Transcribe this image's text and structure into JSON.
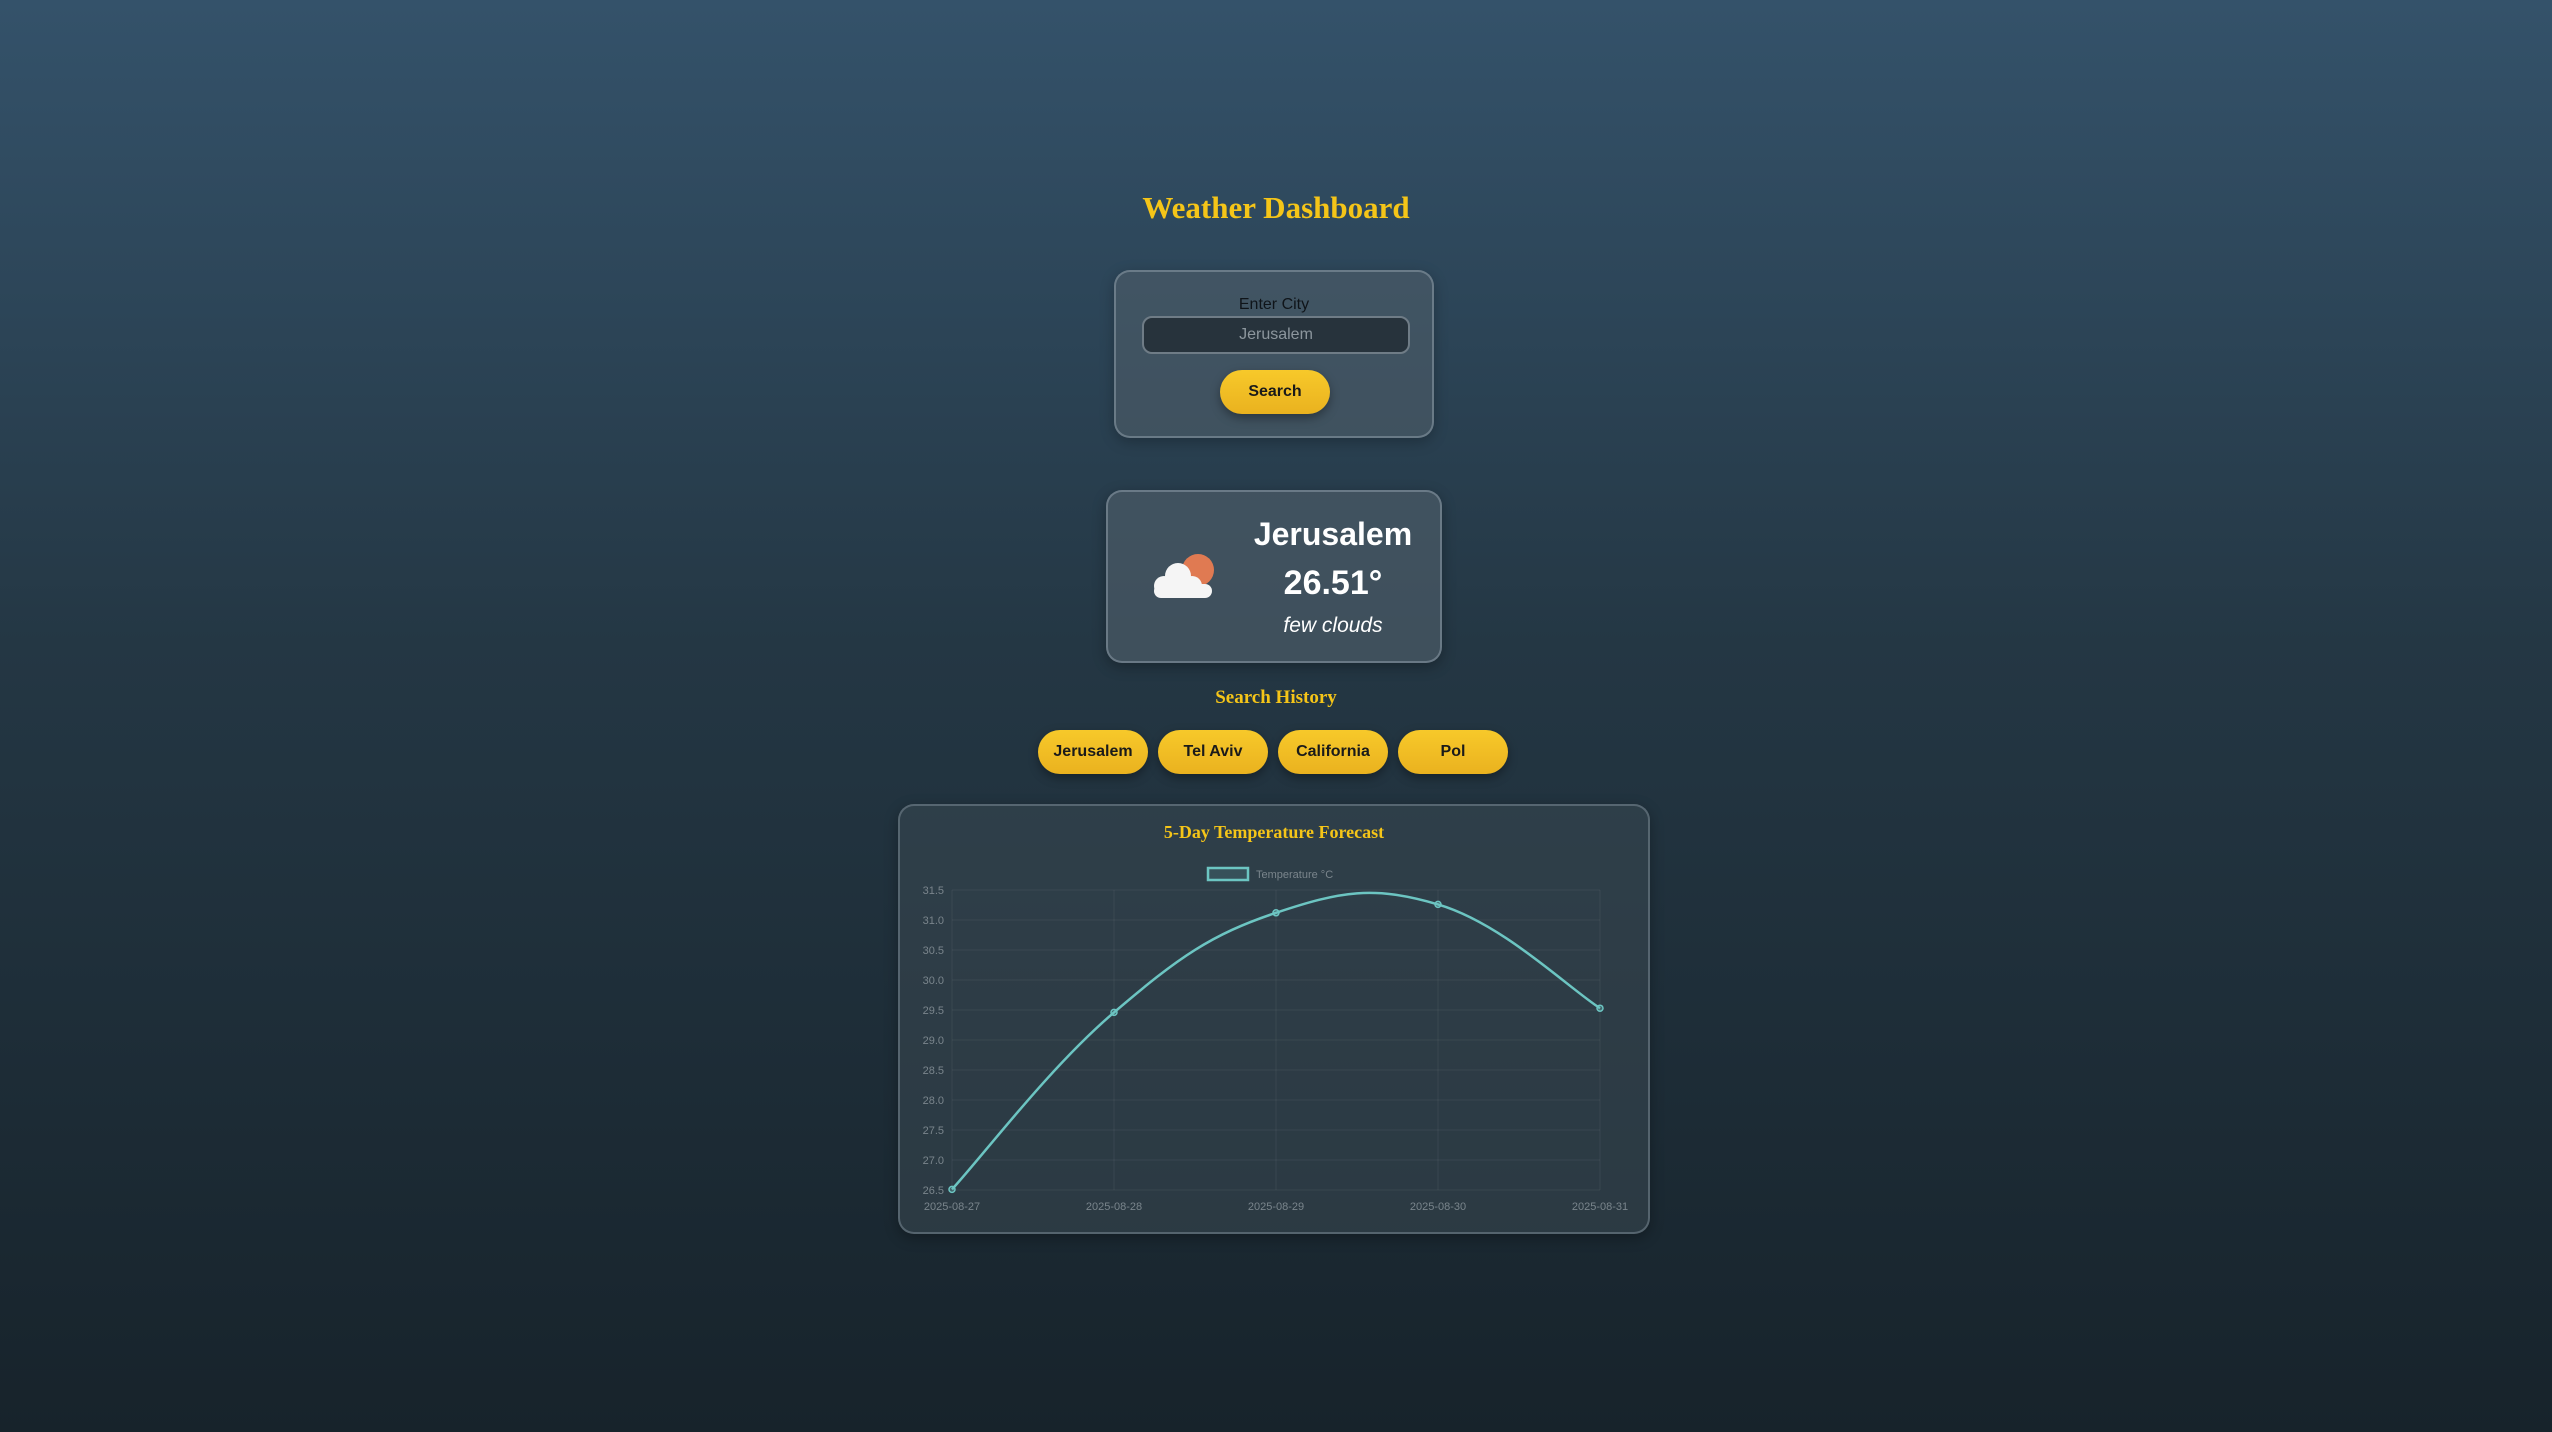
{
  "header": {
    "title": "Weather Dashboard"
  },
  "search": {
    "label": "Enter City",
    "placeholder": "Jerusalem",
    "value": "",
    "button_label": "Search"
  },
  "current": {
    "icon": "few-clouds-icon",
    "city": "Jerusalem",
    "temperature": "26.51°",
    "description": "few clouds"
  },
  "history": {
    "title": "Search History",
    "items": [
      "Jerusalem",
      "Tel Aviv",
      "California",
      "Pol"
    ]
  },
  "colors": {
    "accent": "#f5c518",
    "line": "#6cc5c2"
  },
  "chart_data": {
    "type": "line",
    "title": "5-Day Temperature Forecast",
    "x": [
      "2025-08-27",
      "2025-08-28",
      "2025-08-29",
      "2025-08-30",
      "2025-08-31"
    ],
    "series": [
      {
        "name": "Temperature °C",
        "values": [
          26.51,
          29.46,
          31.12,
          31.26,
          29.53
        ]
      }
    ],
    "ylim": [
      26.5,
      31.5
    ],
    "yticks": [
      "31.5",
      "31.0",
      "30.5",
      "30.0",
      "29.5",
      "29.0",
      "28.5",
      "28.0",
      "27.5",
      "27.0",
      "26.5"
    ],
    "grid": true,
    "legend": "top-center",
    "xlabel": "",
    "ylabel": ""
  }
}
